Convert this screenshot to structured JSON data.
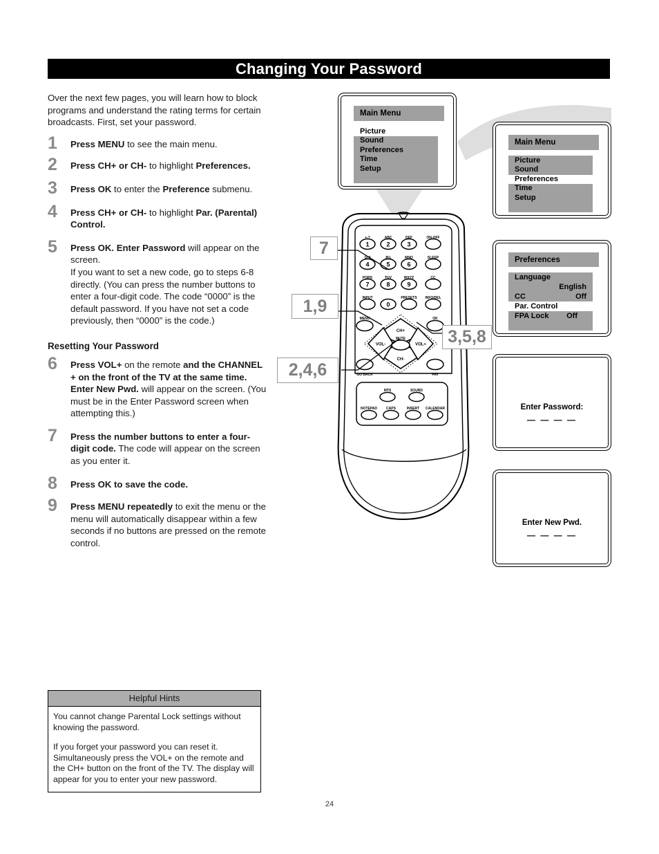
{
  "header": {
    "title": "Changing Your Password"
  },
  "intro": "Over the next few pages, you will learn how to block programs and understand the rating terms for certain broadcasts. First, set your password.",
  "steps": [
    {
      "num": "1",
      "html": "<b>Press MENU</b> to see the main menu."
    },
    {
      "num": "2",
      "html": "<b>Press CH+ or CH-</b> to highlight <b>Preferences.</b>"
    },
    {
      "num": "3",
      "html": "<b>Press OK</b> to enter the <b>Preference</b> submenu."
    },
    {
      "num": "4",
      "html": "<b>Press CH+ or CH-</b> to highlight <b>Par. (Parental) Control.</b>"
    },
    {
      "num": "5",
      "html": "<b>Press OK. Enter Password</b> will appear on the screen.<br>If you want to set a new code, go to steps 6-8 directly. (You can press the number buttons to enter a four-digit code. The code &ldquo;0000&rdquo; is the default password. If you have not set a code previously, then &ldquo;0000&rdquo; is the code.)"
    },
    {
      "num": "6",
      "html": "<b>Press VOL+</b> on the remote <b>and the CHANNEL + on the front of the TV at the same time. Enter New Pwd.</b> will appear on the screen. (You must be in the Enter Password screen when attempting this.)"
    },
    {
      "num": "7",
      "html": "<b>Press the number buttons to enter a four-digit code.</b> The code will appear on the screen as you enter it."
    },
    {
      "num": "8",
      "html": "<b>Press OK to save the code.</b>"
    },
    {
      "num": "9",
      "html": "<b>Press MENU repeatedly</b> to exit the menu or the menu will automatically disappear within a few seconds if no buttons are pressed on the remote control."
    }
  ],
  "subheading": "Resetting Your Password",
  "hints": {
    "header": "Helpful Hints",
    "paragraph1": "You cannot change Parental Lock settings without knowing the password.",
    "paragraph2": "If you forget your password you can reset it. Simultaneously press the VOL+ on the remote and the CH+ button on the front of the TV. The display will appear for you to enter your new password."
  },
  "page_number": "24",
  "screens": {
    "main_menu_1": {
      "title": "Main Menu",
      "items": [
        "Picture",
        "Sound",
        "Preferences",
        "Time",
        "Setup"
      ],
      "highlighted": "Picture"
    },
    "main_menu_2": {
      "title": "Main Menu",
      "items": [
        "Picture",
        "Sound",
        "Preferences",
        "Time",
        "Setup"
      ],
      "highlighted": "Preferences"
    },
    "preferences": {
      "title": "Preferences",
      "rows": [
        {
          "label": "Language",
          "value": "English"
        },
        {
          "label": "CC",
          "value": "Off"
        },
        {
          "label": "Par. Control",
          "value": ""
        },
        {
          "label": "FPA Lock",
          "value": "Off"
        }
      ],
      "highlighted": "Par. Control"
    },
    "enter_password": {
      "prompt": "Enter Password:",
      "dashes": "— — — —"
    },
    "enter_new_pwd": {
      "prompt": "Enter New Pwd.",
      "dashes": "— — — —"
    }
  },
  "callouts": [
    {
      "id": "callout-7",
      "label": "7"
    },
    {
      "id": "callout-1-9",
      "label": "1,9"
    },
    {
      "id": "callout-2-4-6",
      "label": "2,4,6"
    },
    {
      "id": "callout-3-5-8",
      "label": "3,5,8"
    }
  ],
  "remote": {
    "keypad": [
      {
        "sub": "+-?",
        "main": "1"
      },
      {
        "sub": "ABC",
        "main": "2"
      },
      {
        "sub": "DEF",
        "main": "3"
      },
      {
        "sub": "ON-OFF",
        "main": ""
      },
      {
        "sub": "GHI",
        "main": "4"
      },
      {
        "sub": "JKL",
        "main": "5"
      },
      {
        "sub": "MNO",
        "main": "6"
      },
      {
        "sub": "SLEEP",
        "main": ""
      },
      {
        "sub": "PQRS",
        "main": "7"
      },
      {
        "sub": "TUV",
        "main": "8"
      },
      {
        "sub": "WXYZ",
        "main": "9"
      },
      {
        "sub": "CC",
        "main": ""
      },
      {
        "sub": "INPUT",
        "main": ""
      },
      {
        "sub": "",
        "main": "0"
      },
      {
        "sub": "PRESETS",
        "main": ""
      },
      {
        "sub": "INFO/DEL",
        "main": ""
      }
    ],
    "nav": {
      "menu": "MENU",
      "ok": "OK",
      "ch_up": "CH+",
      "ch_down": "CH-",
      "vol_down": "VOL-",
      "vol_up": "VOL+",
      "mute": "MUTE",
      "go_back": "GO BACK",
      "fav": "FAV"
    },
    "bottom": [
      "MTS",
      "SOUND",
      "NOTEPAD",
      "CAPS",
      "INSERT",
      "CALENDAR"
    ]
  },
  "colors": {
    "header_bg": "#000000",
    "osd_gray": "#a0a0a0",
    "callout_text": "#808080",
    "step_num": "#8a8a8a",
    "hint_header_bg": "#adadad"
  }
}
